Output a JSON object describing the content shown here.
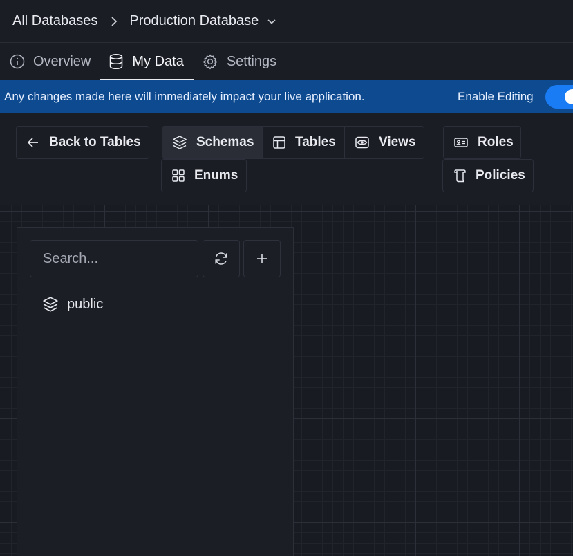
{
  "breadcrumb": {
    "root": "All Databases",
    "separator": ">",
    "current": "Production Database"
  },
  "tabs": [
    {
      "label": "Overview",
      "icon": "info-icon",
      "active": false
    },
    {
      "label": "My Data",
      "icon": "database-icon",
      "active": true
    },
    {
      "label": "Settings",
      "icon": "gear-icon",
      "active": false
    }
  ],
  "banner": {
    "message": "Any changes made here will immediately impact your live application.",
    "toggle_label": "Enable Editing",
    "toggle_on": true,
    "background": "#0d4a8f",
    "toggle_color": "#1a7cf5"
  },
  "toolbar": {
    "back_label": "Back to Tables",
    "segments": [
      {
        "label": "Schemas",
        "icon": "layers-icon",
        "selected": true
      },
      {
        "label": "Tables",
        "icon": "table-icon",
        "selected": false
      },
      {
        "label": "Views",
        "icon": "eye-icon",
        "selected": false
      }
    ],
    "enums_label": "Enums",
    "roles_label": "Roles",
    "policies_label": "Policies"
  },
  "schema_panel": {
    "search_placeholder": "Search...",
    "schemas": [
      {
        "name": "public",
        "icon": "layers-icon"
      }
    ]
  }
}
